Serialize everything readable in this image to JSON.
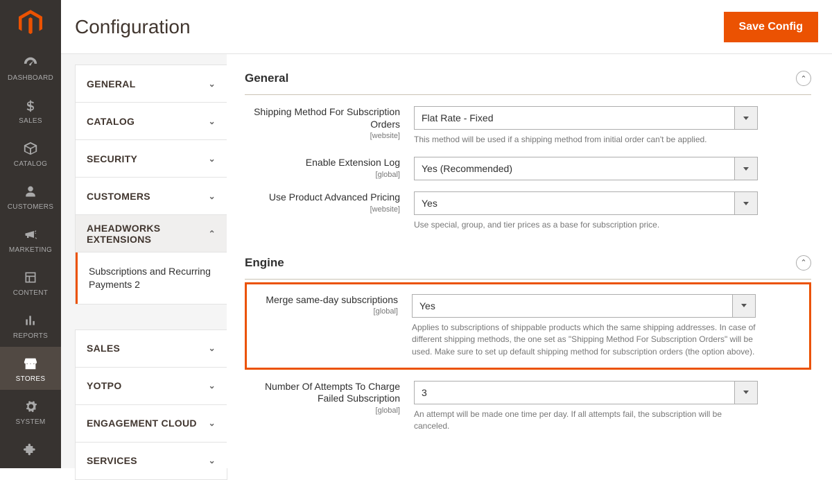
{
  "header": {
    "title": "Configuration",
    "save_label": "Save Config"
  },
  "nav": {
    "items": [
      {
        "name": "dashboard",
        "label": "DASHBOARD"
      },
      {
        "name": "sales",
        "label": "SALES"
      },
      {
        "name": "catalog",
        "label": "CATALOG"
      },
      {
        "name": "customers",
        "label": "CUSTOMERS"
      },
      {
        "name": "marketing",
        "label": "MARKETING"
      },
      {
        "name": "content",
        "label": "CONTENT"
      },
      {
        "name": "reports",
        "label": "REPORTS"
      },
      {
        "name": "stores",
        "label": "STORES"
      },
      {
        "name": "system",
        "label": "SYSTEM"
      },
      {
        "name": "partners",
        "label": ""
      }
    ]
  },
  "sidebar": {
    "groups_top": [
      {
        "label": "GENERAL"
      },
      {
        "label": "CATALOG"
      },
      {
        "label": "SECURITY"
      },
      {
        "label": "CUSTOMERS"
      },
      {
        "label": "AHEADWORKS EXTENSIONS",
        "expanded": true
      }
    ],
    "sub_item": "Subscriptions and Recurring Payments 2",
    "groups_bottom": [
      {
        "label": "SALES"
      },
      {
        "label": "YOTPO"
      },
      {
        "label": "ENGAGEMENT CLOUD"
      },
      {
        "label": "SERVICES"
      }
    ]
  },
  "sections": {
    "general": {
      "title": "General",
      "fields": {
        "shipping_method": {
          "label": "Shipping Method For Subscription Orders",
          "scope": "[website]",
          "value": "Flat Rate - Fixed",
          "note": "This method will be used if a shipping method from initial order can't be applied."
        },
        "enable_log": {
          "label": "Enable Extension Log",
          "scope": "[global]",
          "value": "Yes (Recommended)"
        },
        "advanced_pricing": {
          "label": "Use Product Advanced Pricing",
          "scope": "[website]",
          "value": "Yes",
          "note": "Use special, group, and tier prices as a base for subscription price."
        }
      }
    },
    "engine": {
      "title": "Engine",
      "fields": {
        "merge": {
          "label": "Merge same-day subscriptions",
          "scope": "[global]",
          "value": "Yes",
          "note": "Applies to subscriptions of shippable products which the same shipping addresses. In case of different shipping methods, the one set as \"Shipping Method For Subscription Orders\" will be used. Make sure to set up default shipping method for subscription orders (the option above)."
        },
        "attempts": {
          "label": "Number Of Attempts To Charge Failed Subscription",
          "scope": "[global]",
          "value": "3",
          "note": "An attempt will be made one time per day. If all attempts fail, the subscription will be canceled."
        }
      }
    }
  }
}
